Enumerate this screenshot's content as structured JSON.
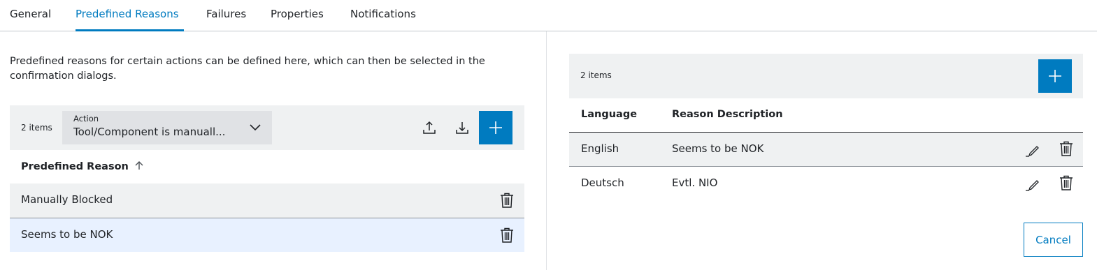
{
  "tabs": [
    {
      "label": "General",
      "active": false
    },
    {
      "label": "Predefined Reasons",
      "active": true
    },
    {
      "label": "Failures",
      "active": false
    },
    {
      "label": "Properties",
      "active": false
    },
    {
      "label": "Notifications",
      "active": false
    }
  ],
  "colors": {
    "accent": "#007bc0",
    "toolbar_bg": "#eff1f2",
    "select_bg": "#e0e2e5",
    "selected_row_bg": "#e8f1ff",
    "row_bg": "#eff1f2"
  },
  "left": {
    "intro": "Predefined reasons for certain actions can be defined here, which can then be selected in the confirmation dialogs.",
    "toolbar": {
      "count": "2 items",
      "select_label": "Action",
      "select_value": "Tool/Component is manuall...",
      "icons": [
        "upload-icon",
        "download-icon",
        "add-icon"
      ]
    },
    "table": {
      "header": "Predefined Reason",
      "sort_icon": "arrow-up-icon",
      "rows": [
        {
          "reason": "Manually Blocked",
          "selected": false
        },
        {
          "reason": "Seems to be NOK",
          "selected": true
        }
      ]
    }
  },
  "right": {
    "toolbar": {
      "count": "2 items",
      "icons": [
        "add-icon"
      ]
    },
    "table": {
      "headers": {
        "language": "Language",
        "description": "Reason Description"
      },
      "rows": [
        {
          "language": "English",
          "description": "Seems to be NOK"
        },
        {
          "language": "Deutsch",
          "description": "Evtl. NIO"
        }
      ]
    },
    "cancel_label": "Cancel"
  }
}
